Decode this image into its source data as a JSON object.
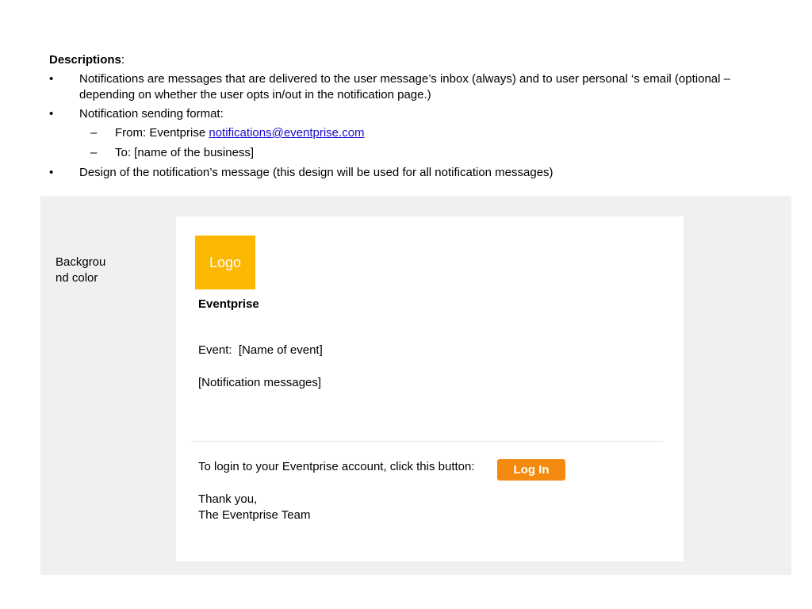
{
  "descriptions": {
    "title": "Descriptions",
    "title_colon": ":",
    "bullet_mark": "•",
    "dash_mark": "–",
    "items": [
      "Notifications are  messages that are delivered to the user message’s inbox (always) and to user personal ‘s email (optional – depending on whether the user opts in/out in the notification page.)",
      "Notification sending format:",
      "Design of the notification’s message (this design will be used for all notification messages)"
    ],
    "from_prefix": "From: Eventprise ",
    "from_email": "notifications@eventprise.com",
    "to_line": "To: [name of the business]"
  },
  "panel": {
    "background_label": "Background color",
    "background_color": "#f0f0f0"
  },
  "email": {
    "logo_text": "Logo",
    "logo_color": "#fcb800",
    "brand": "Eventprise",
    "event_line": "Event:  [Name of event]",
    "message": "[Notification messages]",
    "login_text": "To login to your Eventprise account, click this button:",
    "login_button": "Log In",
    "login_button_color": "#f58a10",
    "thanks": "Thank you,",
    "signature": "The Eventprise Team"
  }
}
